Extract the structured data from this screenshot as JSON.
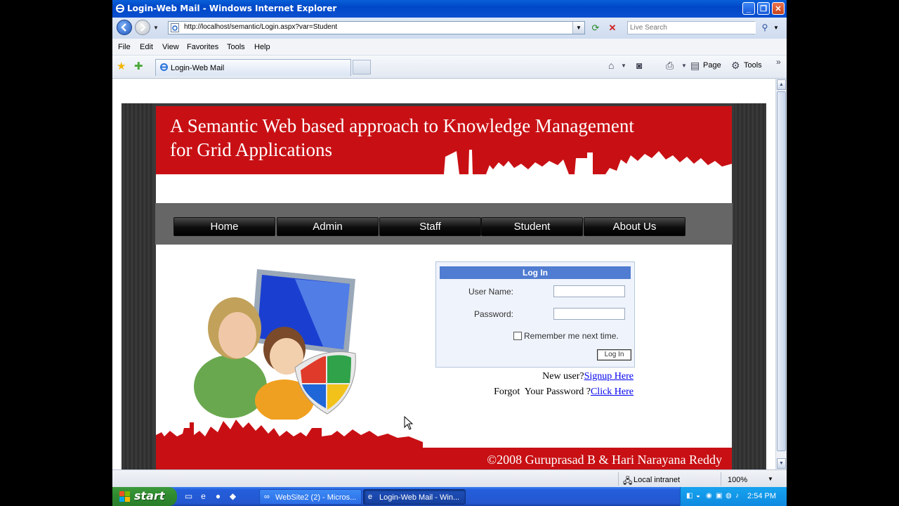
{
  "window": {
    "title": "Login-Web Mail - Windows Internet Explorer",
    "minimize": "_",
    "restore": "❐",
    "close": "✕"
  },
  "addressbar": {
    "url": "http://localhost/semantic/Login.aspx?var=Student",
    "search_placeholder": "Live Search"
  },
  "menubar": [
    "File",
    "Edit",
    "View",
    "Favorites",
    "Tools",
    "Help"
  ],
  "tabs": [
    {
      "label": "Login-Web Mail",
      "active": true
    }
  ],
  "commandbar": {
    "page": "Page",
    "tools": "Tools"
  },
  "site": {
    "banner_line1": "A Semantic Web based approach to Knowledge Management",
    "banner_line2": "for Grid Applications",
    "nav": [
      "Home",
      "Admin",
      "Staff",
      "Student",
      "About Us"
    ],
    "login": {
      "header": "Log In",
      "username_label": "User Name:",
      "password_label": "Password:",
      "username_value": "",
      "password_value": "",
      "remember_label": "Remember me next time.",
      "remember_checked": false,
      "button": "Log In"
    },
    "new_user_text": "New user?",
    "signup_link": "Signup Here",
    "forgot_text": "Forgot  Your Password ?",
    "forgot_link": "Click Here",
    "footer": "©2008 Guruprasad B & Hari Narayana Reddy",
    "brand_red": "#c81014"
  },
  "statusbar": {
    "zone": "Local intranet",
    "zoom": "100%"
  },
  "taskbar": {
    "start": "start",
    "tasks": [
      {
        "label": "WebSite2 (2) - Micros...",
        "active": false
      },
      {
        "label": "Login-Web Mail - Win...",
        "active": true
      }
    ],
    "clock": "2:54 PM"
  }
}
